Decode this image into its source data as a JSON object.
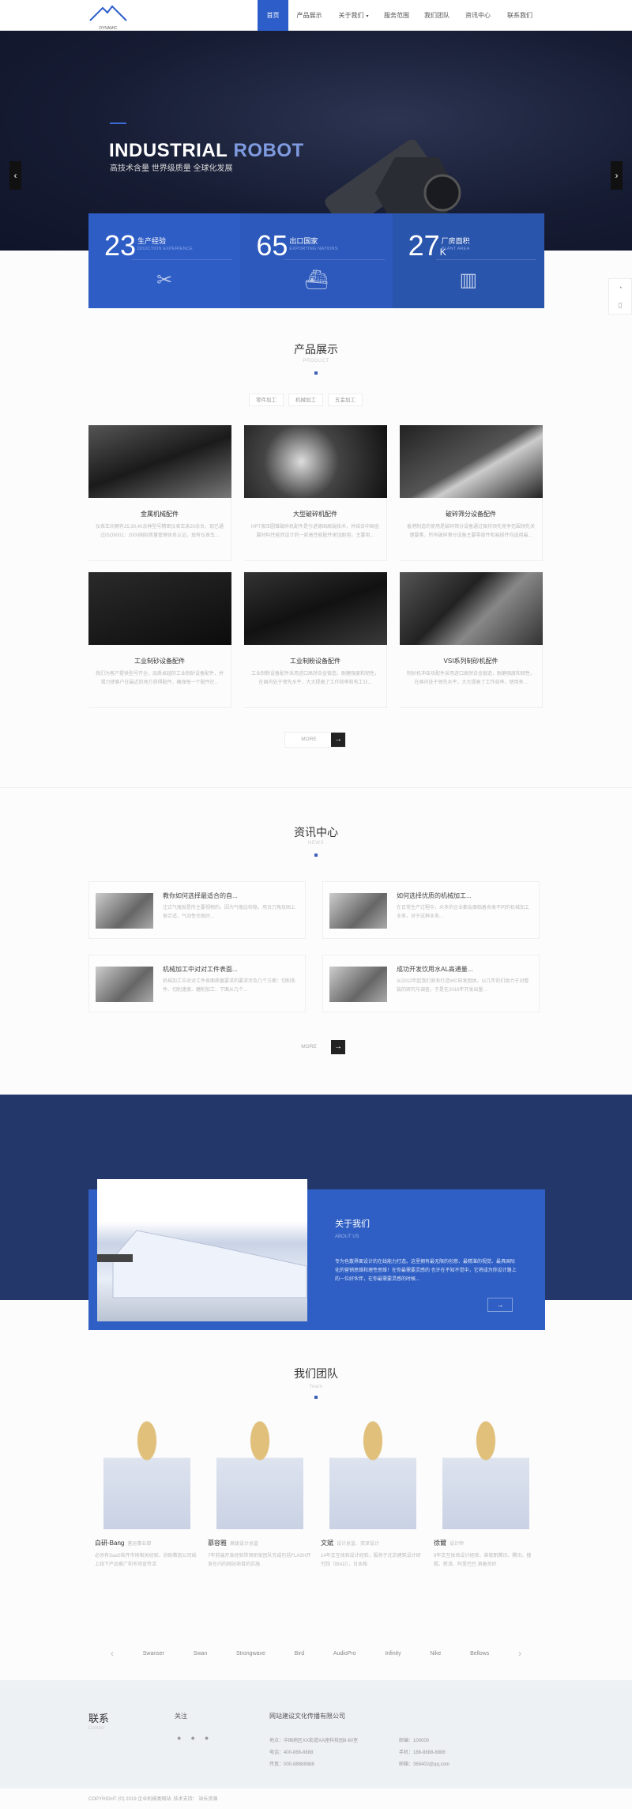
{
  "nav": {
    "logo_text": "DYNAMIC",
    "items": [
      {
        "label": "首页",
        "active": true
      },
      {
        "label": "产品展示"
      },
      {
        "label": "关于我们",
        "dropdown": true
      },
      {
        "label": "服务范围"
      },
      {
        "label": "我们团队"
      },
      {
        "label": "资讯中心"
      },
      {
        "label": "联系我们"
      }
    ]
  },
  "hero": {
    "title_white": "INDUSTRIAL",
    "title_blue": "ROBOT",
    "subtitle": "高技术含量 世界级质量 全球化发展",
    "prev": "‹",
    "next": "›"
  },
  "stats": [
    {
      "number": "23",
      "suffix": "",
      "label": "生产经验",
      "en": "DDUCTION EXPERIENCE",
      "icon": "tools-icon",
      "glyph": "✂"
    },
    {
      "number": "65",
      "suffix": "",
      "label": "出口国家",
      "en": "EXPORTING NATIONS",
      "icon": "ship-icon",
      "glyph": "⛴"
    },
    {
      "number": "27",
      "suffix": "K",
      "label": "厂房面积",
      "en": "PLANT AREA",
      "icon": "building-icon",
      "glyph": "▥"
    }
  ],
  "colors": {
    "accent": "#2c5dc8",
    "dark": "#23376a",
    "about": "#2f5fc4"
  },
  "products": {
    "title": "产品展示",
    "en": "PRODUCT",
    "tabs": [
      "零件加工",
      "机械加工",
      "五金加工"
    ],
    "items": [
      {
        "title": "金属机械配件",
        "desc": "仪表车间拥有25,30,40余种型号精密仪表车床20余台，现已通过ISO9001：2000国际质量管理体系认证，现有仪表车..."
      },
      {
        "title": "大型破碎机配件",
        "desc": "HPT液压圆锥破碎机配件是引进德国高端技术，并结合中国金属材料性能而设计的一款高性能配件更加耐用，主要用..."
      },
      {
        "title": "破碎筛分设备配件",
        "desc": "香港制造的使用是破碎筛分设备通过保持领先竞争范围领先关键要素，所有破碎筛分设备主要零部件和易损件均选用最..."
      },
      {
        "title": "工业制砂设备配件",
        "desc": "我们为客户提供型号齐全、品质卓越的工业制砂设备配件，并竭力使客户在最近的地方获得配件，确保每一个配件在..."
      },
      {
        "title": "工业制粉设备配件",
        "desc": "工业制粉设备配件采用进口高然合金锻造，耐磨强度和韧性，在国内处于领先水平，大大提高了工作效率和有工业..."
      },
      {
        "title": "VSI系列制砂机配件",
        "desc": "制砂机冲击块配件采用进口高然合金锻造，耐磨强度和韧性，在国内处于领先水平，大大提高了工作效率，使用寿..."
      }
    ],
    "more": "MORE"
  },
  "news": {
    "title": "资讯中心",
    "en": "NEWS",
    "items": [
      {
        "title": "教你如何选择最适合的自...",
        "desc": "注式气瓶就是所主要视物的，因为气瓶比较稳，用台刀角及固上很合适，气动性也很好..."
      },
      {
        "title": "如何选择优质的机械加工...",
        "desc": "在日常生产过程中，众多的企业都会面临着各类不同的机械加工业务，对于这种业务..."
      },
      {
        "title": "机械加工中对对工件表面...",
        "desc": "机械加工中对对工件表面质量要求的要求涉及几个方面：切削条件、切削速度、磨削加工、下面从几个..."
      },
      {
        "title": "成功开发饮用水AL高通量...",
        "desc": "从2012年起我们就有打造WC研发团体，以几年的们致力于对整装的研究与调查，于是在2016年开发出量..."
      }
    ],
    "more": "MORE"
  },
  "about": {
    "title": "关于我们",
    "en": "ABOUT US",
    "text": "专为色散界面设计的在线能力打造。这里拥有最无限的创意、最精湛的视觉、最具国际化的营销思维和理性思维！在你最需要灵感的 也许在不知不觉中，它将成为你设计路上的一位好伙伴，在你最需要灵感的时候...",
    "button": "→"
  },
  "team": {
    "title": "我们团队",
    "en": "Team",
    "members": [
      {
        "name": "白研-Bang",
        "role": "营运事业部",
        "desc": "必须有SaaS软件市场相关经验，协助策划公司线上线下产品推广和市场宣传活"
      },
      {
        "name": "慕容雅",
        "role": "高级设计总监",
        "desc": "7年前端开发经验带领研发团队完成包括FLASH开发在内的网站项目的实施"
      },
      {
        "name": "文斌",
        "role": "设计总监、资深设计",
        "desc": "14年交互体验设计经验，服务于北京建筑设计研究院（BIAD），日本株"
      },
      {
        "name": "徐爾",
        "role": "设计师",
        "desc": "9年交互体验设计经验，曾就职腾讯、腾讯、搜狐、新浪、阿里巴巴 具备良好"
      }
    ]
  },
  "partners": {
    "prev": "‹",
    "next": "›",
    "logos": [
      "Swanser",
      "Swan",
      "Strongwave",
      "Bird",
      "AudioPro",
      "Infinity",
      "Nike",
      "Bellows"
    ]
  },
  "footer": {
    "contact_title": "联系",
    "contact_en": "Contact",
    "follow_title": "关注",
    "follow_icons": [
      "weibo-icon",
      "qq-icon",
      "wechat-icon"
    ],
    "company": "网站建设文化传播有限公司",
    "left": [
      "地点：中国地区XX街道XA座科技园8-80室",
      "电话：400-888-8888",
      "传真：000-88888888"
    ],
    "right": [
      "邮编：100000",
      "手机：188-8888-8888",
      "邮箱：369402@qq.com"
    ],
    "copyright": "COPYRIGHT (©) 2019 企业机械类网站. 技术支持：",
    "support": "站长资源"
  },
  "side_tools": [
    "qq-icon",
    "phone-icon"
  ]
}
